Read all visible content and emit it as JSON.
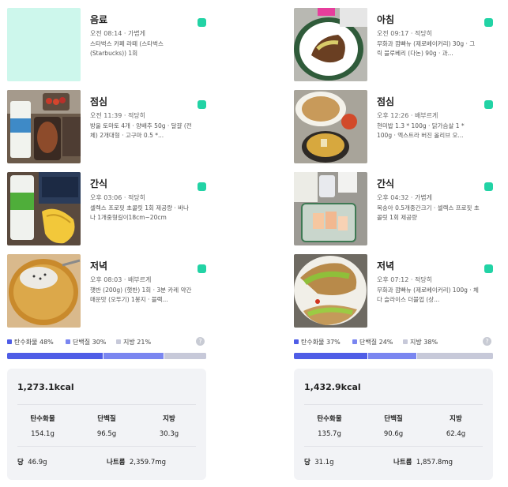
{
  "legend_labels": {
    "carb": "탄수화물",
    "protein": "단백질",
    "fat": "지방",
    "help": "?"
  },
  "nutrient_labels": {
    "carb": "탄수화물",
    "protein": "단백질",
    "fat": "지방",
    "sugar": "당",
    "sodium": "나트륨"
  },
  "colors": {
    "carb": "#4f5de6",
    "protein": "#7a86f0",
    "fat": "#c7c9d9",
    "check": "#22d3a5",
    "card_bg": "#f2f3f6"
  },
  "days": [
    {
      "meals": [
        {
          "title": "음료",
          "meta": "오전 08:14 · 가볍게",
          "desc": "스타벅스 카페 라떼 (스타벅스(Starbucks)) 1회",
          "image": "mint-placeholder"
        },
        {
          "title": "점심",
          "meta": "오전 11:39 · 적당히",
          "desc": "방울 토마토 4개 · 양배추 50g · 달걀 (전체) 2개대형 · 고구마 0.5 *...",
          "image": "lunch-photo"
        },
        {
          "title": "간식",
          "meta": "오후 03:06 · 적당히",
          "desc": "셀렉스 프로핏 초콜릿 1회 제공량 · 바나나 1개중형길이18cm~20cm",
          "image": "snack-photo"
        },
        {
          "title": "저녁",
          "meta": "오후 08:03 · 배부르게",
          "desc": "햇반 (200g) (햇반) 1회 · 3분 카레 약간매운맛 (오뚜기) 1봉지 · 블랙...",
          "image": "dinner-photo"
        }
      ],
      "ratio": {
        "carb_pct": 48,
        "protein_pct": 30,
        "fat_pct": 21,
        "carb_text": "탄수화물 48%",
        "protein_text": "단백질 30%",
        "fat_text": "지방 21%"
      },
      "summary": {
        "kcal": "1,273.1kcal",
        "carb": "154.1g",
        "protein": "96.5g",
        "fat": "30.3g",
        "sugar": "46.9g",
        "sodium": "2,359.7mg"
      }
    },
    {
      "meals": [
        {
          "title": "아침",
          "meta": "오전 09:17 · 적당히",
          "desc": "무화과 깜빠뉴 (제로베이커리) 30g · 그릭 블루베리 (다논) 90g · 과...",
          "image": "breakfast-photo"
        },
        {
          "title": "점심",
          "meta": "오후 12:26 · 배부르게",
          "desc": "현미밥 1.3 * 100g · 닭가슴살 1 * 100g · 엑스트라 버진 올리브 오...",
          "image": "lunch-photo"
        },
        {
          "title": "간식",
          "meta": "오후 04:32 · 가볍게",
          "desc": "복숭아 0.5개중간크기 · 셀렉스 프로핏 초콜릿 1회 제공량",
          "image": "snack-photo"
        },
        {
          "title": "저녁",
          "meta": "오후 07:12 · 적당히",
          "desc": "무화과 깜빠뉴 (제로베이커리) 100g · 체다 슬라이스 더블업 (상...",
          "image": "dinner-photo"
        }
      ],
      "ratio": {
        "carb_pct": 37,
        "protein_pct": 24,
        "fat_pct": 38,
        "carb_text": "탄수화물 37%",
        "protein_text": "단백질 24%",
        "fat_text": "지방 38%"
      },
      "summary": {
        "kcal": "1,432.9kcal",
        "carb": "135.7g",
        "protein": "90.6g",
        "fat": "62.4g",
        "sugar": "31.1g",
        "sodium": "1,857.8mg"
      }
    }
  ]
}
